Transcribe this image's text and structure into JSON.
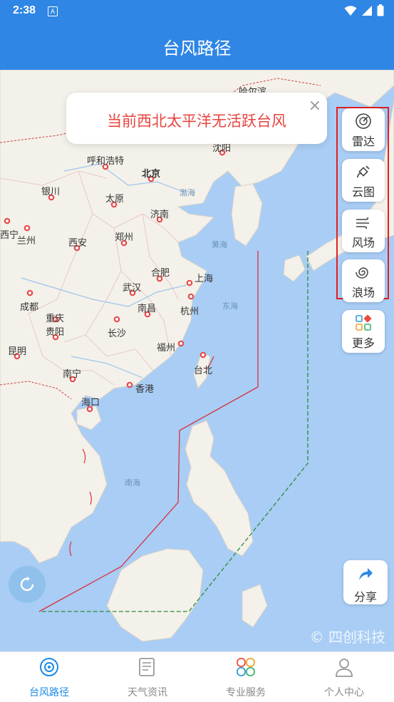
{
  "status": {
    "time": "2:38"
  },
  "header": {
    "title": "台风路径"
  },
  "toast": {
    "message": "当前西北太平洋无活跃台风",
    "close": "×"
  },
  "tools": {
    "radar": "雷达",
    "cloud": "云图",
    "wind": "风场",
    "wave": "浪场",
    "more": "更多"
  },
  "share": {
    "label": "分享"
  },
  "watermark": "© 四创科技",
  "map": {
    "cities": [
      "哈尔滨",
      "沈阳",
      "呼和浩特",
      "北京",
      "银川",
      "太原",
      "济南",
      "西宁",
      "兰州",
      "西安",
      "郑州",
      "合肥",
      "上海",
      "武汉",
      "南昌",
      "杭州",
      "成都",
      "重庆",
      "贵阳",
      "长沙",
      "福州",
      "台北",
      "昆明",
      "南宁",
      "香港",
      "海口"
    ],
    "seas": [
      "渤海",
      "黄海",
      "东海",
      "南海"
    ]
  },
  "tabs": [
    {
      "label": "台风路径"
    },
    {
      "label": "天气资讯"
    },
    {
      "label": "专业服务"
    },
    {
      "label": "个人中心"
    }
  ],
  "colors": {
    "primary": "#2f86e4",
    "toast_text": "#e8443f",
    "active_tab": "#1c8ae6"
  }
}
